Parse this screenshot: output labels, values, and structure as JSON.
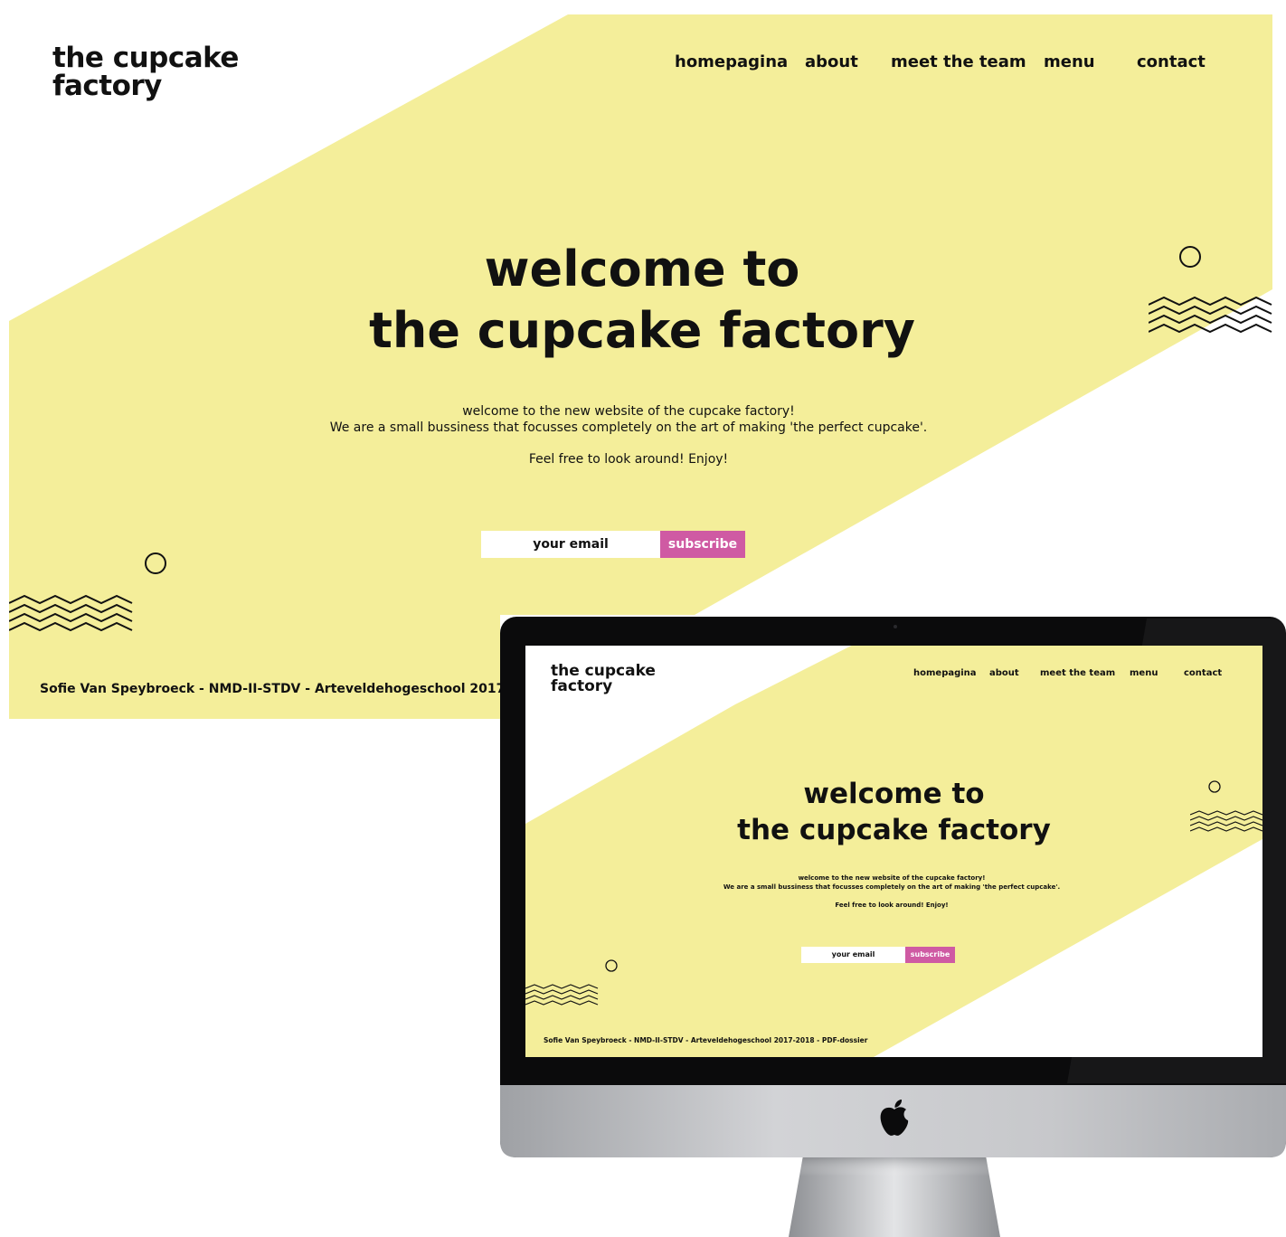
{
  "site": {
    "logo_line1": "the cupcake",
    "logo_line2": "factory",
    "nav": [
      "homepagina",
      "about",
      "meet the team",
      "menu",
      "contact"
    ],
    "hero_line1": "welcome to",
    "hero_line2": "the cupcake factory",
    "intro_line1": "welcome to the new website of the cupcake factory!",
    "intro_line2": "We are a small bussiness that focusses completely on the art of making 'the perfect cupcake'.",
    "intro_line3": "Feel free to look around! Enjoy!",
    "email_placeholder": "your email",
    "subscribe_label": "subscribe",
    "footer": "Sofie Van Speybroeck - NMD-II-STDV - Arteveldehogeschool 2017-2018 - PDF-dossier",
    "footer_clipped": "Sofie Van Speybroeck - NMD-II-STDV - Arteveldehogeschool 2017-2018 -"
  },
  "colors": {
    "yellow": "#f4ee9a",
    "pink": "#cf5aa3",
    "text": "#111111",
    "bezel": "#0b0b0c",
    "chin": "#c8c9cc"
  },
  "icons": {
    "monitor_logo": "apple-logo-icon"
  }
}
